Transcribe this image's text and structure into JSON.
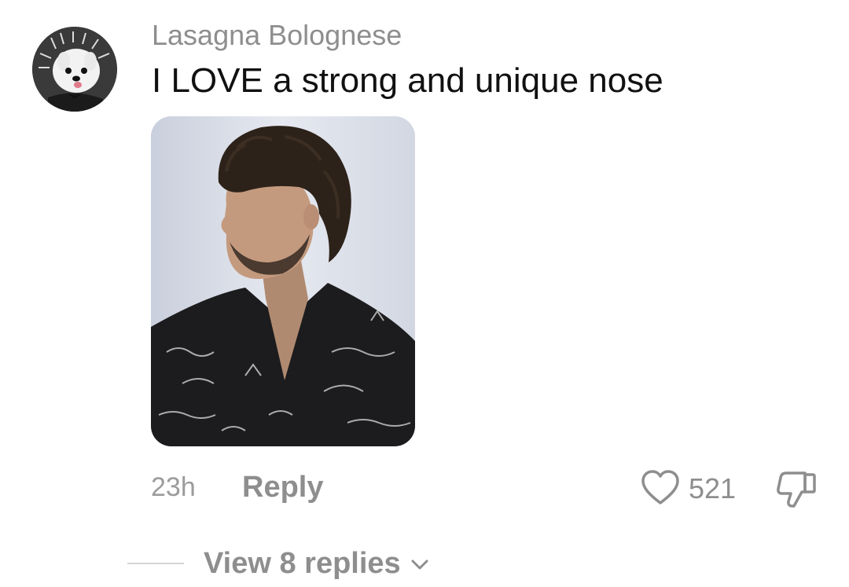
{
  "comment": {
    "author": "Lasagna Bolognese",
    "text": "I LOVE a strong and unique nose",
    "avatar_icon": "dog-avatar",
    "attachment_icon": "photo-man-profile",
    "timestamp": "23h",
    "reply_label": "Reply",
    "like_count": "521",
    "like_icon": "heart-icon",
    "dislike_icon": "thumbs-down-icon"
  },
  "replies": {
    "label": "View 8 replies",
    "icon": "chevron-down-icon"
  },
  "colors": {
    "muted_text": "#8e8e8e",
    "body_text": "#111111",
    "background": "#ffffff"
  }
}
